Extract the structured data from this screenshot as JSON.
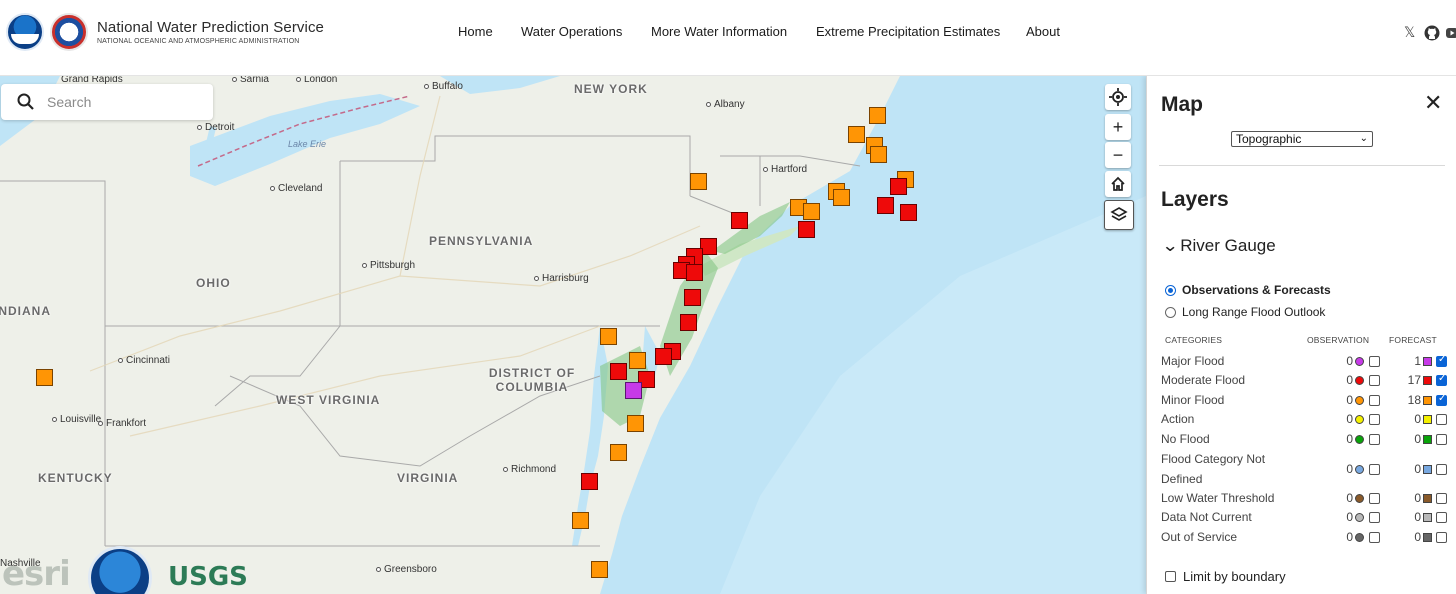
{
  "header": {
    "brand_title": "National Water Prediction Service",
    "brand_subtitle": "NATIONAL OCEANIC AND ATMOSPHERIC ADMINISTRATION",
    "nav": [
      "Home",
      "Water Operations",
      "More Water Information",
      "Extreme Precipitation Estimates",
      "About"
    ],
    "social_icons": [
      "x-icon",
      "github-icon",
      "youtube-icon"
    ]
  },
  "map": {
    "search_placeholder": "Search",
    "state_labels": [
      "NEW YORK",
      "PENNSYLVANIA",
      "OHIO",
      "INDIANA",
      "WEST VIRGINIA",
      "KENTUCKY",
      "VIRGINIA",
      "DISTRICT OF COLUMBIA"
    ],
    "cities": [
      "Grand Rapids",
      "Sarnia",
      "London",
      "Buffalo",
      "Albany",
      "Detroit",
      "Cleveland",
      "Hartford",
      "Pittsburgh",
      "Harrisburg",
      "Cincinnati",
      "Louisville",
      "Frankfort",
      "Richmond",
      "Nashville",
      "Greensboro"
    ],
    "water_label": "Lake Erie",
    "attribution": [
      "esri",
      "NOAA",
      "USGS"
    ],
    "controls": [
      "locate-icon",
      "zoom-in-icon",
      "zoom-out-icon",
      "home-icon",
      "layers-icon"
    ]
  },
  "panel": {
    "title": "Map",
    "basemap": "Topographic",
    "layers_title": "Layers",
    "group_title": "River Gauge",
    "modes": [
      {
        "label": "Observations & Forecasts",
        "selected": true
      },
      {
        "label": "Long Range Flood Outlook",
        "selected": false
      }
    ],
    "col_categories": "CATEGORIES",
    "col_observation": "OBSERVATION",
    "col_forecast": "FORECAST",
    "categories": [
      {
        "label": "Major Flood",
        "obs": "0",
        "fc": "1",
        "color": "#c73ae8",
        "fc_checked": true
      },
      {
        "label": "Moderate Flood",
        "obs": "0",
        "fc": "17",
        "color": "#ee0a0a",
        "fc_checked": true
      },
      {
        "label": "Minor Flood",
        "obs": "0",
        "fc": "18",
        "color": "#ff9505",
        "fc_checked": true
      },
      {
        "label": "Action",
        "obs": "0",
        "fc": "0",
        "color": "#f4f000",
        "fc_checked": false
      },
      {
        "label": "No Flood",
        "obs": "0",
        "fc": "0",
        "color": "#0aa40a",
        "fc_checked": false
      },
      {
        "label": "Flood Category Not Defined",
        "obs": "0",
        "fc": "0",
        "color": "#78a8e0",
        "fc_checked": false
      },
      {
        "label": "Low Water Threshold",
        "obs": "0",
        "fc": "0",
        "color": "#8a5a2a",
        "fc_checked": false
      },
      {
        "label": "Data Not Current",
        "obs": "0",
        "fc": "0",
        "color": "#b9b9b9",
        "fc_checked": false
      },
      {
        "label": "Out of Service",
        "obs": "0",
        "fc": "0",
        "color": "#666666",
        "fc_checked": false
      }
    ],
    "limit_label": "Limit by boundary"
  }
}
